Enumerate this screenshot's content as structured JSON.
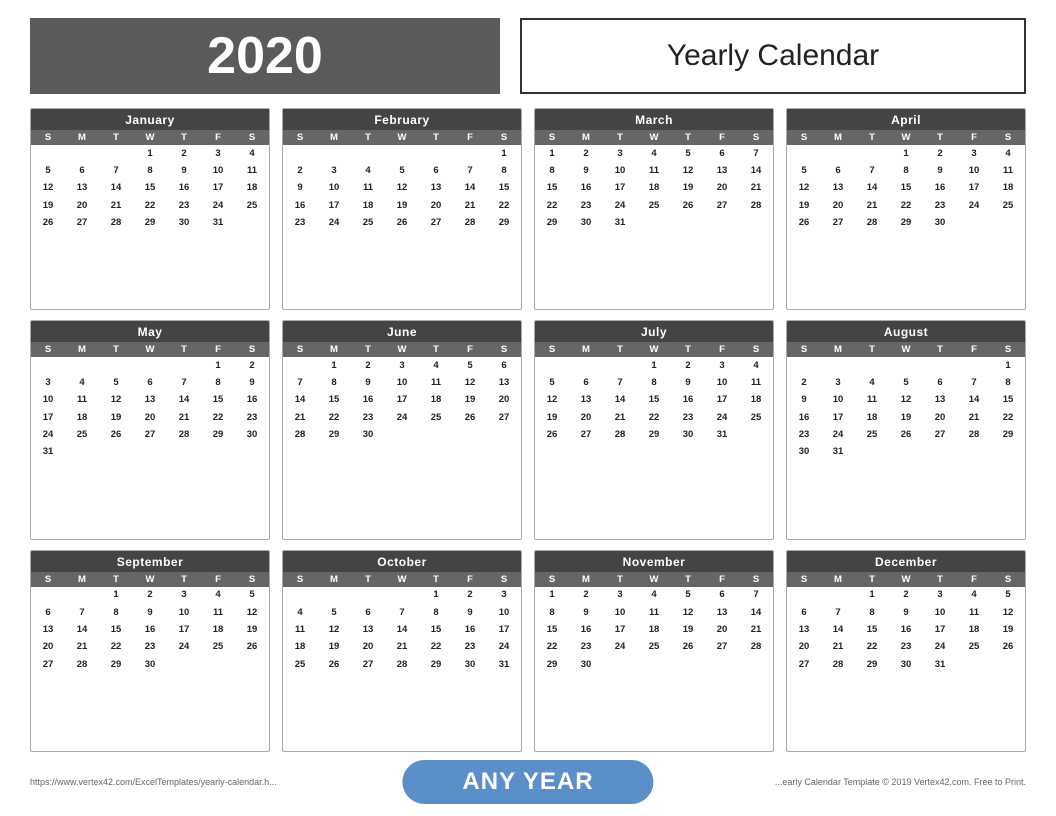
{
  "header": {
    "year": "2020",
    "title": "Yearly Calendar"
  },
  "footer": {
    "left": "https://www.vertex42.com/ExcelTemplates/yearly-calendar.h...",
    "center": "ANY YEAR",
    "right": "...early Calendar Template © 2019 Vertex42.com. Free to Print."
  },
  "months": [
    {
      "name": "January",
      "dows": [
        "S",
        "M",
        "T",
        "W",
        "T",
        "F",
        "S"
      ],
      "weeks": [
        [
          "",
          "",
          "",
          "1",
          "2",
          "3",
          "4"
        ],
        [
          "5",
          "6",
          "7",
          "8",
          "9",
          "10",
          "11"
        ],
        [
          "12",
          "13",
          "14",
          "15",
          "16",
          "17",
          "18"
        ],
        [
          "19",
          "20",
          "21",
          "22",
          "23",
          "24",
          "25"
        ],
        [
          "26",
          "27",
          "28",
          "29",
          "30",
          "31",
          ""
        ]
      ]
    },
    {
      "name": "February",
      "dows": [
        "S",
        "M",
        "T",
        "W",
        "T",
        "F",
        "S"
      ],
      "weeks": [
        [
          "",
          "",
          "",
          "",
          "",
          "",
          "1"
        ],
        [
          "2",
          "3",
          "4",
          "5",
          "6",
          "7",
          "8"
        ],
        [
          "9",
          "10",
          "11",
          "12",
          "13",
          "14",
          "15"
        ],
        [
          "16",
          "17",
          "18",
          "19",
          "20",
          "21",
          "22"
        ],
        [
          "23",
          "24",
          "25",
          "26",
          "27",
          "28",
          "29"
        ]
      ]
    },
    {
      "name": "March",
      "dows": [
        "S",
        "M",
        "T",
        "W",
        "T",
        "F",
        "S"
      ],
      "weeks": [
        [
          "1",
          "2",
          "3",
          "4",
          "5",
          "6",
          "7"
        ],
        [
          "8",
          "9",
          "10",
          "11",
          "12",
          "13",
          "14"
        ],
        [
          "15",
          "16",
          "17",
          "18",
          "19",
          "20",
          "21"
        ],
        [
          "22",
          "23",
          "24",
          "25",
          "26",
          "27",
          "28"
        ],
        [
          "29",
          "30",
          "31",
          "",
          "",
          "",
          ""
        ]
      ]
    },
    {
      "name": "April",
      "dows": [
        "S",
        "M",
        "T",
        "W",
        "T",
        "F",
        "S"
      ],
      "weeks": [
        [
          "",
          "",
          "",
          "1",
          "2",
          "3",
          "4"
        ],
        [
          "5",
          "6",
          "7",
          "8",
          "9",
          "10",
          "11"
        ],
        [
          "12",
          "13",
          "14",
          "15",
          "16",
          "17",
          "18"
        ],
        [
          "19",
          "20",
          "21",
          "22",
          "23",
          "24",
          "25"
        ],
        [
          "26",
          "27",
          "28",
          "29",
          "30",
          "",
          ""
        ]
      ]
    },
    {
      "name": "May",
      "dows": [
        "S",
        "M",
        "T",
        "W",
        "T",
        "F",
        "S"
      ],
      "weeks": [
        [
          "",
          "",
          "",
          "",
          "",
          "1",
          "2"
        ],
        [
          "3",
          "4",
          "5",
          "6",
          "7",
          "8",
          "9"
        ],
        [
          "10",
          "11",
          "12",
          "13",
          "14",
          "15",
          "16"
        ],
        [
          "17",
          "18",
          "19",
          "20",
          "21",
          "22",
          "23"
        ],
        [
          "24",
          "25",
          "26",
          "27",
          "28",
          "29",
          "30"
        ],
        [
          "31",
          "",
          "",
          "",
          "",
          "",
          ""
        ]
      ]
    },
    {
      "name": "June",
      "dows": [
        "S",
        "M",
        "T",
        "W",
        "T",
        "F",
        "S"
      ],
      "weeks": [
        [
          "",
          "1",
          "2",
          "3",
          "4",
          "5",
          "6"
        ],
        [
          "7",
          "8",
          "9",
          "10",
          "11",
          "12",
          "13"
        ],
        [
          "14",
          "15",
          "16",
          "17",
          "18",
          "19",
          "20"
        ],
        [
          "21",
          "22",
          "23",
          "24",
          "25",
          "26",
          "27"
        ],
        [
          "28",
          "29",
          "30",
          "",
          "",
          "",
          ""
        ]
      ]
    },
    {
      "name": "July",
      "dows": [
        "S",
        "M",
        "T",
        "W",
        "T",
        "F",
        "S"
      ],
      "weeks": [
        [
          "",
          "",
          "",
          "1",
          "2",
          "3",
          "4"
        ],
        [
          "5",
          "6",
          "7",
          "8",
          "9",
          "10",
          "11"
        ],
        [
          "12",
          "13",
          "14",
          "15",
          "16",
          "17",
          "18"
        ],
        [
          "19",
          "20",
          "21",
          "22",
          "23",
          "24",
          "25"
        ],
        [
          "26",
          "27",
          "28",
          "29",
          "30",
          "31",
          ""
        ]
      ]
    },
    {
      "name": "August",
      "dows": [
        "S",
        "M",
        "T",
        "W",
        "T",
        "F",
        "S"
      ],
      "weeks": [
        [
          "",
          "",
          "",
          "",
          "",
          "",
          "1"
        ],
        [
          "2",
          "3",
          "4",
          "5",
          "6",
          "7",
          "8"
        ],
        [
          "9",
          "10",
          "11",
          "12",
          "13",
          "14",
          "15"
        ],
        [
          "16",
          "17",
          "18",
          "19",
          "20",
          "21",
          "22"
        ],
        [
          "23",
          "24",
          "25",
          "26",
          "27",
          "28",
          "29"
        ],
        [
          "30",
          "31",
          "",
          "",
          "",
          "",
          ""
        ]
      ]
    },
    {
      "name": "September",
      "dows": [
        "S",
        "M",
        "T",
        "W",
        "T",
        "F",
        "S"
      ],
      "weeks": [
        [
          "",
          "",
          "1",
          "2",
          "3",
          "4",
          "5"
        ],
        [
          "6",
          "7",
          "8",
          "9",
          "10",
          "11",
          "12"
        ],
        [
          "13",
          "14",
          "15",
          "16",
          "17",
          "18",
          "19"
        ],
        [
          "20",
          "21",
          "22",
          "23",
          "24",
          "25",
          "26"
        ],
        [
          "27",
          "28",
          "29",
          "30",
          "",
          "",
          ""
        ]
      ]
    },
    {
      "name": "October",
      "dows": [
        "S",
        "M",
        "T",
        "W",
        "T",
        "F",
        "S"
      ],
      "weeks": [
        [
          "",
          "",
          "",
          "",
          "1",
          "2",
          "3"
        ],
        [
          "4",
          "5",
          "6",
          "7",
          "8",
          "9",
          "10"
        ],
        [
          "11",
          "12",
          "13",
          "14",
          "15",
          "16",
          "17"
        ],
        [
          "18",
          "19",
          "20",
          "21",
          "22",
          "23",
          "24"
        ],
        [
          "25",
          "26",
          "27",
          "28",
          "29",
          "30",
          "31"
        ]
      ]
    },
    {
      "name": "November",
      "dows": [
        "S",
        "M",
        "T",
        "W",
        "T",
        "F",
        "S"
      ],
      "weeks": [
        [
          "1",
          "2",
          "3",
          "4",
          "5",
          "6",
          "7"
        ],
        [
          "8",
          "9",
          "10",
          "11",
          "12",
          "13",
          "14"
        ],
        [
          "15",
          "16",
          "17",
          "18",
          "19",
          "20",
          "21"
        ],
        [
          "22",
          "23",
          "24",
          "25",
          "26",
          "27",
          "28"
        ],
        [
          "29",
          "30",
          "",
          "",
          "",
          "",
          ""
        ]
      ]
    },
    {
      "name": "December",
      "dows": [
        "S",
        "M",
        "T",
        "W",
        "T",
        "F",
        "S"
      ],
      "weeks": [
        [
          "",
          "",
          "1",
          "2",
          "3",
          "4",
          "5"
        ],
        [
          "6",
          "7",
          "8",
          "9",
          "10",
          "11",
          "12"
        ],
        [
          "13",
          "14",
          "15",
          "16",
          "17",
          "18",
          "19"
        ],
        [
          "20",
          "21",
          "22",
          "23",
          "24",
          "25",
          "26"
        ],
        [
          "27",
          "28",
          "29",
          "30",
          "31",
          "",
          ""
        ]
      ]
    }
  ]
}
